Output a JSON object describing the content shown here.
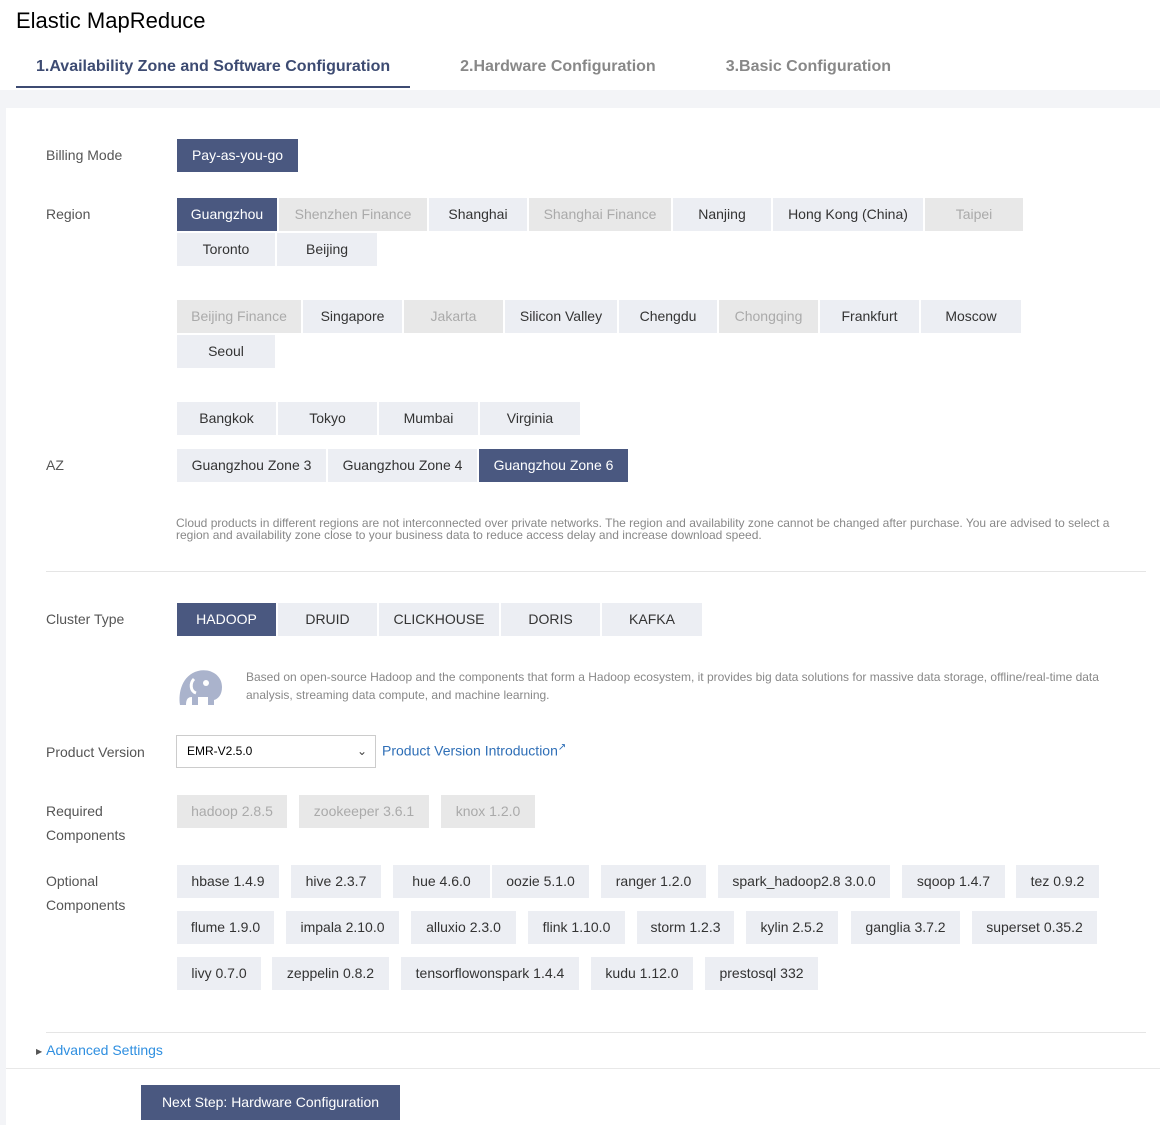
{
  "app": {
    "title": "Elastic MapReduce"
  },
  "steps": [
    {
      "label": "1.Availability Zone and Software Configuration"
    },
    {
      "label": "2.Hardware Configuration"
    },
    {
      "label": "3.Basic Configuration"
    }
  ],
  "billing": {
    "label": "Billing Mode",
    "option": "Pay-as-you-go"
  },
  "region": {
    "label": "Region",
    "groups": [
      [
        "Guangzhou",
        "Shenzhen Finance",
        "Shanghai",
        "Shanghai Finance",
        "Nanjing",
        "Hong Kong (China)",
        "Taipei",
        "Toronto",
        "Beijing"
      ],
      [
        "Beijing Finance",
        "Singapore",
        "Jakarta",
        "Silicon Valley",
        "Chengdu",
        "Chongqing",
        "Frankfurt",
        "Moscow",
        "Seoul"
      ],
      [
        "Bangkok",
        "Tokyo",
        "Mumbai",
        "Virginia"
      ]
    ],
    "selected": "Guangzhou"
  },
  "az": {
    "label": "AZ",
    "options": [
      "Guangzhou Zone 3",
      "Guangzhou Zone 4",
      "Guangzhou Zone 6"
    ],
    "selected": "Guangzhou Zone 6",
    "note_line1": "Cloud products in different regions are not interconnected over private networks. The region and availability zone cannot be changed after purchase. You are advised to select a",
    "note_line2": "region and availability zone close to your business data to reduce access delay and increase download speed."
  },
  "cluster": {
    "label": "Cluster Type",
    "options": [
      "HADOOP",
      "DRUID",
      "CLICKHOUSE",
      "DORIS",
      "KAFKA"
    ],
    "selected": "HADOOP",
    "desc_line1": "Based on open-source Hadoop and the components that form a Hadoop ecosystem, it provides big data solutions for massive data storage, offline/real-time data",
    "desc_line2": "analysis, streaming data compute, and machine learning."
  },
  "version": {
    "label": "Product Version",
    "value": "EMR-V2.5.0",
    "link": "Product Version Introduction"
  },
  "required": {
    "label_line1": "Required",
    "label_line2": "Components",
    "items": [
      "hadoop 2.8.5",
      "zookeeper 3.6.1",
      "knox 1.2.0"
    ]
  },
  "optional": {
    "label_line1": "Optional",
    "label_line2": "Components",
    "rows": [
      [
        "hbase 1.4.9",
        "hive 2.3.7",
        "hue 4.6.0",
        "oozie 5.1.0",
        "ranger 1.2.0",
        "spark_hadoop2.8 3.0.0",
        "sqoop 1.4.7",
        "tez 0.9.2"
      ],
      [
        "flume 1.9.0",
        "impala 2.10.0",
        "alluxio 2.3.0",
        "flink 1.10.0",
        "storm 1.2.3",
        "kylin 2.5.2",
        "ganglia 3.7.2",
        "superset 0.35.2"
      ],
      [
        "livy 0.7.0",
        "zeppelin 0.8.2",
        "tensorflowonspark 1.4.4",
        "kudu 1.12.0",
        "prestosql 332"
      ]
    ]
  },
  "advanced": {
    "label": "Advanced Settings"
  },
  "next": {
    "label": "Next Step: Hardware Configuration"
  },
  "colors": {
    "primary": "#4a5880",
    "link": "#2f6fb7",
    "advanced_link": "#2f8fe0"
  }
}
